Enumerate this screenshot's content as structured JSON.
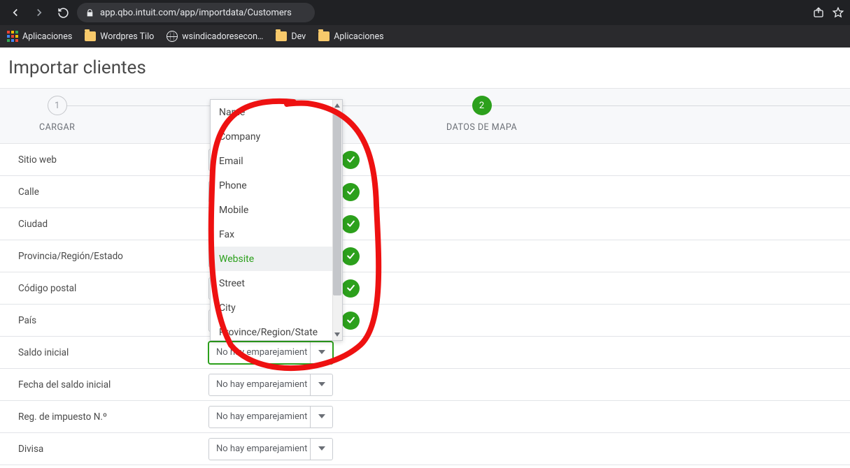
{
  "browser": {
    "url": "app.qbo.intuit.com/app/importdata/Customers",
    "bookmarks": {
      "apps": "Aplicaciones",
      "items": [
        {
          "icon": "folder",
          "label": "Wordpres Tilo"
        },
        {
          "icon": "globe",
          "label": "wsindicadoresecon…"
        },
        {
          "icon": "folder",
          "label": "Dev"
        },
        {
          "icon": "folder",
          "label": "Aplicaciones"
        }
      ]
    }
  },
  "page": {
    "title": "Importar clientes",
    "steps": [
      {
        "num": "1",
        "label": "CARGAR",
        "state": "inactive"
      },
      {
        "num": "2",
        "label": "DATOS DE MAPA",
        "state": "active"
      }
    ]
  },
  "dropdown": {
    "items": [
      "Name",
      "Company",
      "Email",
      "Phone",
      "Mobile",
      "Fax",
      "Website",
      "Street",
      "City",
      "Province/Region/State"
    ],
    "highlighted": "Website"
  },
  "map_rows": [
    {
      "label": "Sitio web",
      "selected": "",
      "check": true,
      "expanded": true
    },
    {
      "label": "Calle",
      "selected": "",
      "check": true
    },
    {
      "label": "Ciudad",
      "selected": "",
      "check": true
    },
    {
      "label": "Provincia/Región/Estado",
      "selected": "",
      "check": true
    },
    {
      "label": "Código postal",
      "selected": "",
      "check": true
    },
    {
      "label": "País",
      "selected": "",
      "check": true
    },
    {
      "label": "Saldo inicial",
      "selected": "No hay emparejamient",
      "check": false,
      "focused": true
    },
    {
      "label": "Fecha del saldo inicial",
      "selected": "No hay emparejamient",
      "check": false
    },
    {
      "label": "Reg. de impuesto N.º",
      "selected": "No hay emparejamient",
      "check": false
    },
    {
      "label": "Divisa",
      "selected": "No hay emparejamient",
      "check": false
    }
  ]
}
